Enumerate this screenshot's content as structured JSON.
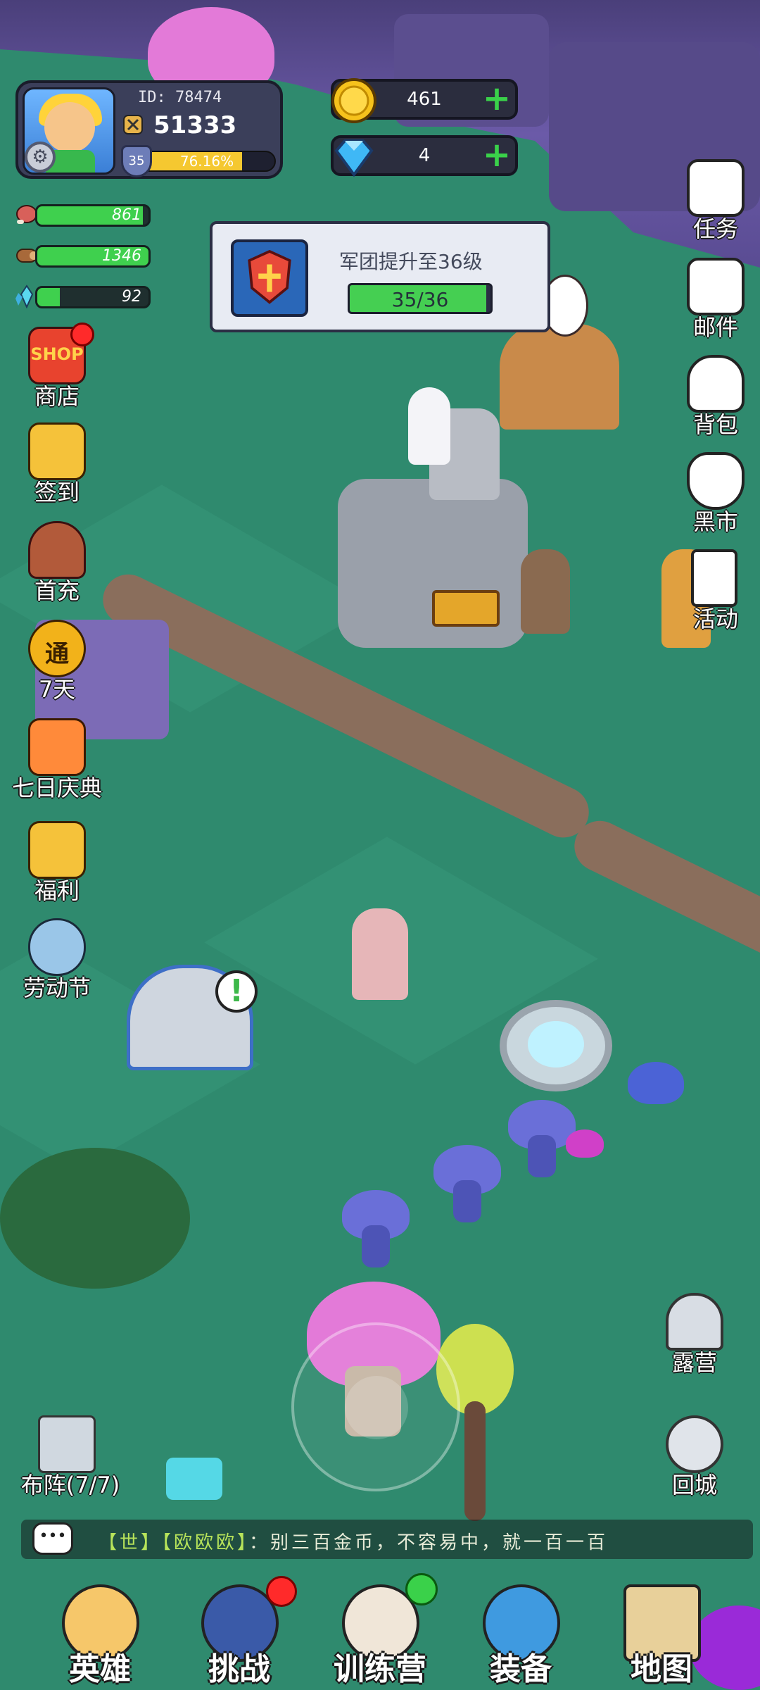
{
  "player": {
    "id_label": "ID: 78474",
    "power": "51333",
    "level": "35",
    "exp_percent": "76.16%",
    "exp_fraction": 0.7616
  },
  "currencies": [
    {
      "name": "gold-coin-icon",
      "value": "461"
    },
    {
      "name": "diamond-icon",
      "value": "4"
    }
  ],
  "resources": [
    {
      "name": "meat-icon",
      "value": "861",
      "fill": 0.95
    },
    {
      "name": "wood-icon",
      "value": "1346",
      "fill": 1.0
    },
    {
      "name": "crystal-icon",
      "value": "92",
      "fill": 0.2
    }
  ],
  "notice": {
    "title": "军团提升至36级",
    "progress": "35/36",
    "fraction": 0.97
  },
  "left_menu": [
    {
      "label": "商店",
      "icon": "shop-icon"
    },
    {
      "label": "签到",
      "icon": "gift-box-icon"
    },
    {
      "label": "首充",
      "icon": "archer-icon"
    },
    {
      "label": "7天",
      "icon": "pass-coin-icon"
    },
    {
      "label": "七日庆典",
      "icon": "gift-box-icon"
    },
    {
      "label": "福利",
      "icon": "gift-box-icon"
    },
    {
      "label": "劳动节",
      "icon": "fist-icon"
    }
  ],
  "right_menu": [
    {
      "label": "任务",
      "icon": "clipboard-check-icon"
    },
    {
      "label": "邮件",
      "icon": "envelope-icon"
    },
    {
      "label": "背包",
      "icon": "backpack-icon"
    },
    {
      "label": "黑市",
      "icon": "money-bag-icon"
    },
    {
      "label": "活动",
      "icon": "cards-icon"
    }
  ],
  "map_buttons": {
    "camp": "露营",
    "return_city": "回城",
    "formation": "布阵(7/7)"
  },
  "chat": {
    "channel": "【世】",
    "sender": "【欧欧欧】",
    "message": "：别三百金币，不容易中，就一百一百"
  },
  "bottom_nav": [
    {
      "label": "英雄",
      "icon": "heroes-icon"
    },
    {
      "label": "挑战",
      "icon": "sword-icon"
    },
    {
      "label": "训练营",
      "icon": "target-icon"
    },
    {
      "label": "装备",
      "icon": "armor-icon"
    },
    {
      "label": "地图",
      "icon": "map-icon"
    }
  ],
  "building_alert": "!"
}
